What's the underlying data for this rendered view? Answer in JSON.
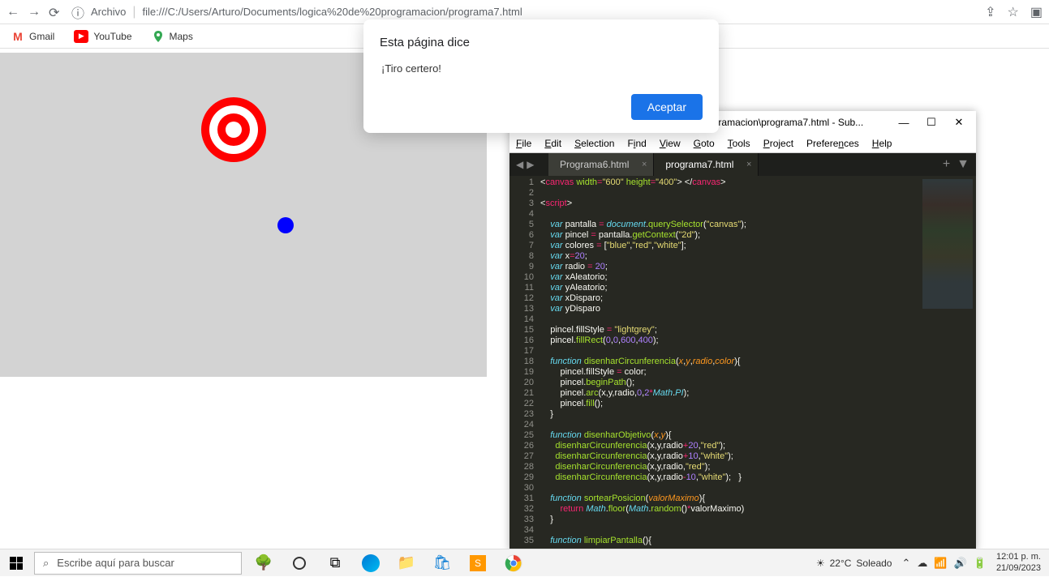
{
  "browser": {
    "archivo_label": "Archivo",
    "url": "file:///C:/Users/Arturo/Documents/logica%20de%20programacion/programa7.html"
  },
  "bookmarks": {
    "gmail": "Gmail",
    "youtube": "YouTube",
    "maps": "Maps"
  },
  "alert": {
    "title": "Esta página dice",
    "message": "¡Tiro certero!",
    "ok": "Aceptar"
  },
  "sublime": {
    "title": "C:\\Users\\Arturo\\Documents\\logica de programacion\\programa7.html - Sub...",
    "menus": [
      "File",
      "Edit",
      "Selection",
      "Find",
      "View",
      "Goto",
      "Tools",
      "Project",
      "Preferences",
      "Help"
    ],
    "tabs": {
      "inactive": "Programa6.html",
      "active": "programa7.html"
    },
    "line_numbers": [
      "1",
      "2",
      "3",
      "4",
      "5",
      "6",
      "7",
      "8",
      "9",
      "10",
      "11",
      "12",
      "13",
      "14",
      "15",
      "16",
      "17",
      "18",
      "19",
      "20",
      "21",
      "22",
      "23",
      "24",
      "25",
      "26",
      "27",
      "28",
      "29",
      "30",
      "31",
      "32",
      "33",
      "34",
      "35"
    ]
  },
  "taskbar": {
    "search_placeholder": "Escribe aquí para buscar",
    "weather_temp": "22°C",
    "weather_text": "Soleado",
    "time": "12:01 p. m.",
    "date": "21/09/2023"
  }
}
